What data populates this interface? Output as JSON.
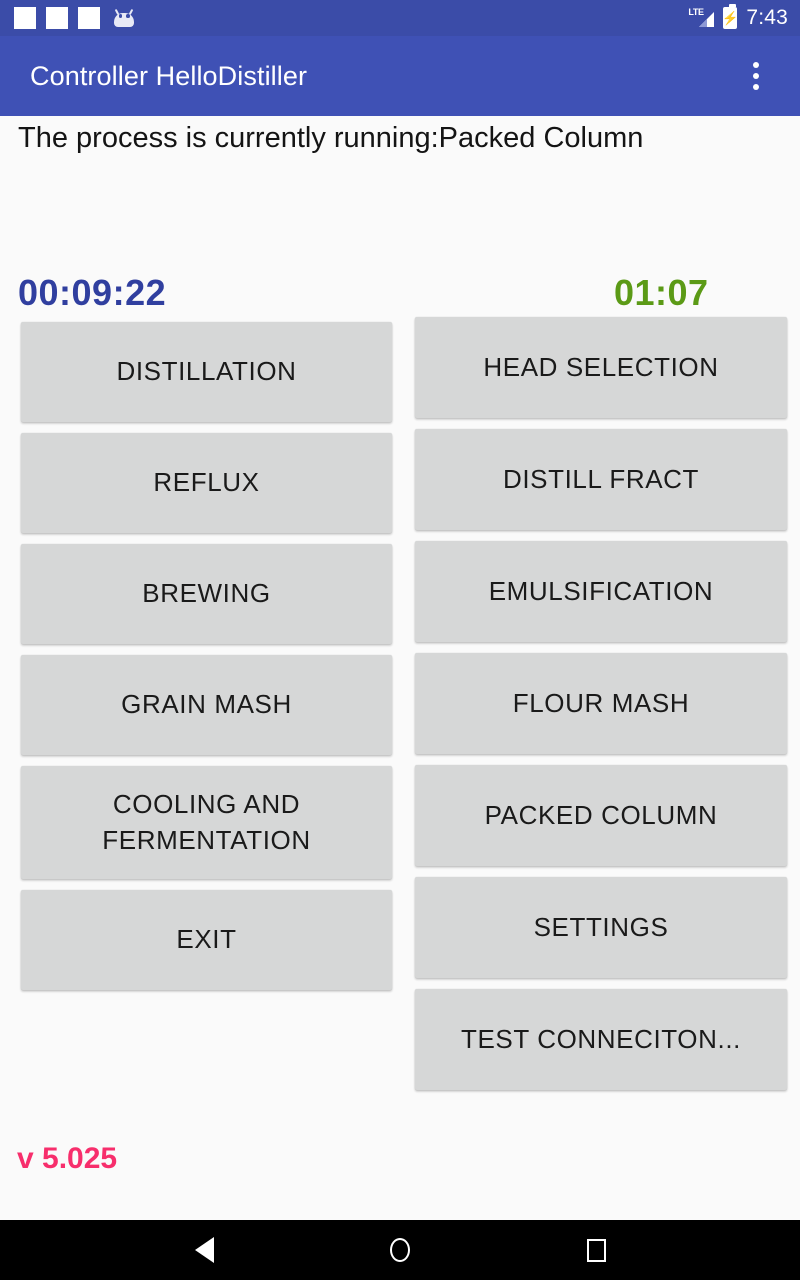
{
  "status_bar": {
    "notification_icons": [
      "blank-square",
      "blank-square",
      "blank-square",
      "android-head"
    ],
    "network_label": "LTE",
    "battery_state": "charging",
    "time": "7:43",
    "background_color": "#3b4ca8"
  },
  "app_bar": {
    "title": "Controller HelloDistiller",
    "overflow_menu": "more-options",
    "background_color": "#3f51b5"
  },
  "main": {
    "process_status": "The process is currently running:Packed Column",
    "timer_main": "00:09:22",
    "timer_main_color": "#303f9f",
    "timer_sub": "01:07",
    "timer_sub_color": "#5b9a16",
    "version": "v 5.025",
    "version_color": "#f72e6c",
    "left_buttons": [
      {
        "label": "DISTILLATION",
        "name": "distillation-button"
      },
      {
        "label": "REFLUX",
        "name": "reflux-button"
      },
      {
        "label": "BREWING",
        "name": "brewing-button"
      },
      {
        "label": "GRAIN MASH",
        "name": "grain-mash-button"
      },
      {
        "label": "COOLING AND FERMENTATION",
        "name": "cooling-and-fermentation-button"
      },
      {
        "label": "EXIT",
        "name": "exit-button"
      }
    ],
    "right_buttons": [
      {
        "label": "HEAD SELECTION",
        "name": "head-selection-button"
      },
      {
        "label": "DISTILL FRACT",
        "name": "distill-fract-button"
      },
      {
        "label": "EMULSIFICATION",
        "name": "emulsification-button"
      },
      {
        "label": "FLOUR MASH",
        "name": "flour-mash-button"
      },
      {
        "label": "PACKED COLUMN",
        "name": "packed-column-button"
      },
      {
        "label": "SETTINGS",
        "name": "settings-button"
      },
      {
        "label": "TEST CONNECITON...",
        "name": "test-connection-button"
      }
    ],
    "button_color": "#d6d7d7"
  },
  "nav_bar": {
    "back": "back-triangle",
    "home": "home-circle",
    "recents": "recents-square"
  }
}
